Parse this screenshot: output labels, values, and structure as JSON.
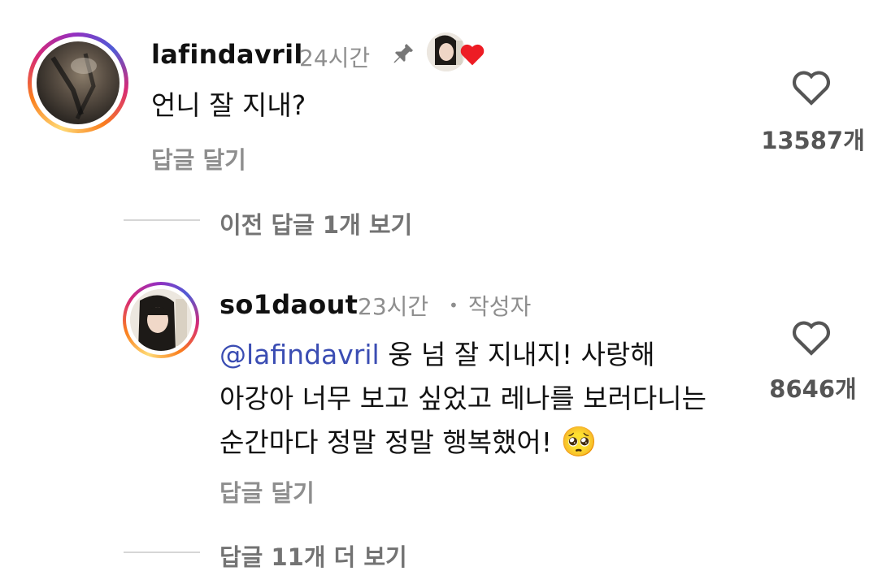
{
  "comments": [
    {
      "username": "lafindavril",
      "time": "24시간",
      "pinned_icon": "pin-icon",
      "liked_by_author_icon": "heart-filled-icon",
      "text": "언니 잘 지내?",
      "reply_label": "답글 달기",
      "like_count": "13587개",
      "like_icon": "heart-outline-icon"
    },
    {
      "username": "so1daout",
      "time": "23시간",
      "separator": "•",
      "badge": "작성자",
      "mention": "@lafindavril",
      "text_line1": " 웅 넘 잘 지내지! 사랑해",
      "text_line2": "아강아 너무 보고 싶었고 레나를 보러다니는",
      "text_line3": "순간마다 정말 정말 행복했어!",
      "emoji": "🥺",
      "reply_label": "답글 달기",
      "like_count": "8646개",
      "like_icon": "heart-outline-icon"
    }
  ],
  "threads": {
    "previous_replies": "이전 답글 1개 보기",
    "more_replies": "답글 11개 더 보기"
  },
  "colors": {
    "mention": "#3b4db3",
    "heart": "#ed1c24",
    "muted": "#8e8e8e"
  }
}
